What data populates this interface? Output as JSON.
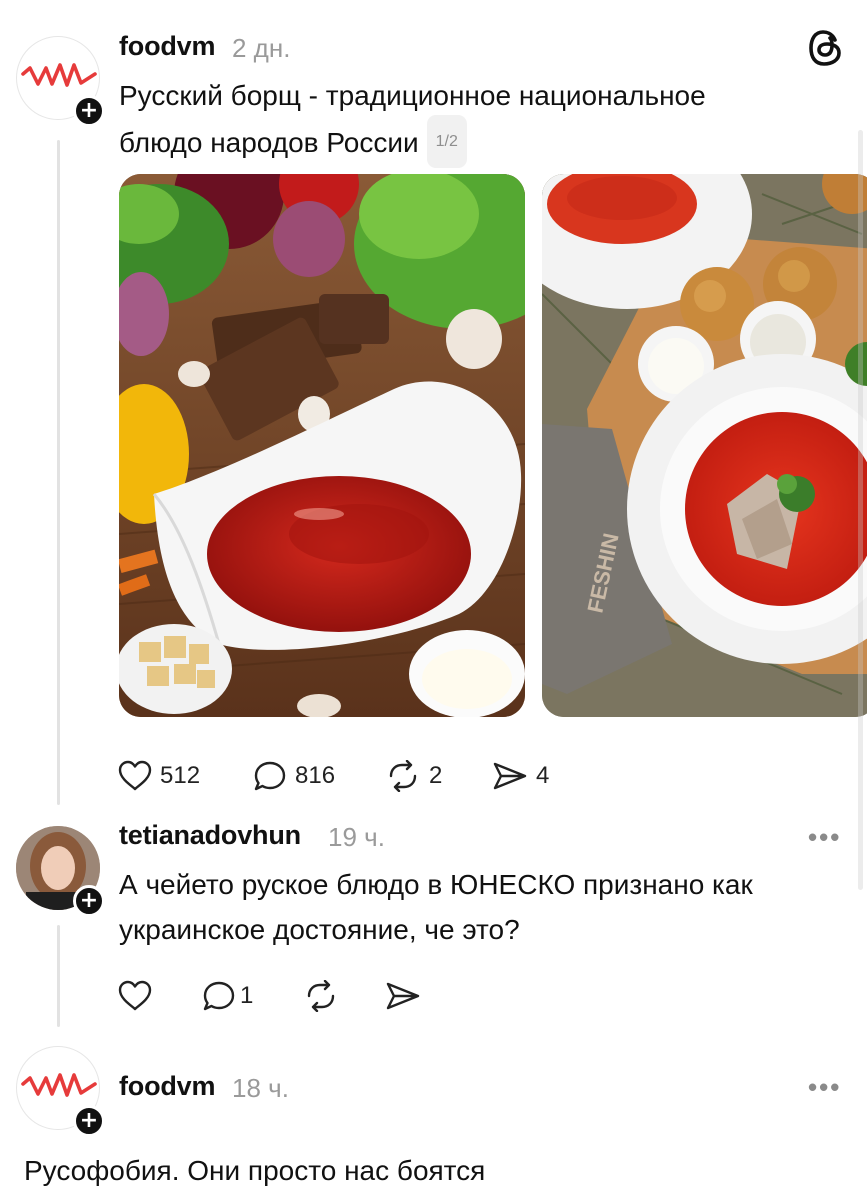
{
  "post": {
    "username": "foodvm",
    "time": "2 дн.",
    "text_line1": "Русский борщ - традиционное национальное",
    "text_line2": "блюдо народов России",
    "image_counter": "1/2",
    "likes": "512",
    "comments": "816",
    "reposts": "2",
    "shares": "4"
  },
  "reply1": {
    "username": "tetianadovhun",
    "time": "19 ч.",
    "text_line1": "А чейето руское блюдо в ЮНЕСКО признано как",
    "text_line2": "украинское достояние,  че это?",
    "comments": "1",
    "more": "•••"
  },
  "reply2": {
    "username": "foodvm",
    "time": "18 ч.",
    "text": "Русофобия. Они просто нас боятся",
    "more": "•••"
  },
  "logo": {
    "text": "VM",
    "color": "#e63b3b"
  },
  "colors": {
    "accent": "#111111",
    "muted": "#9a9a9a",
    "line": "#e2e2e2"
  }
}
